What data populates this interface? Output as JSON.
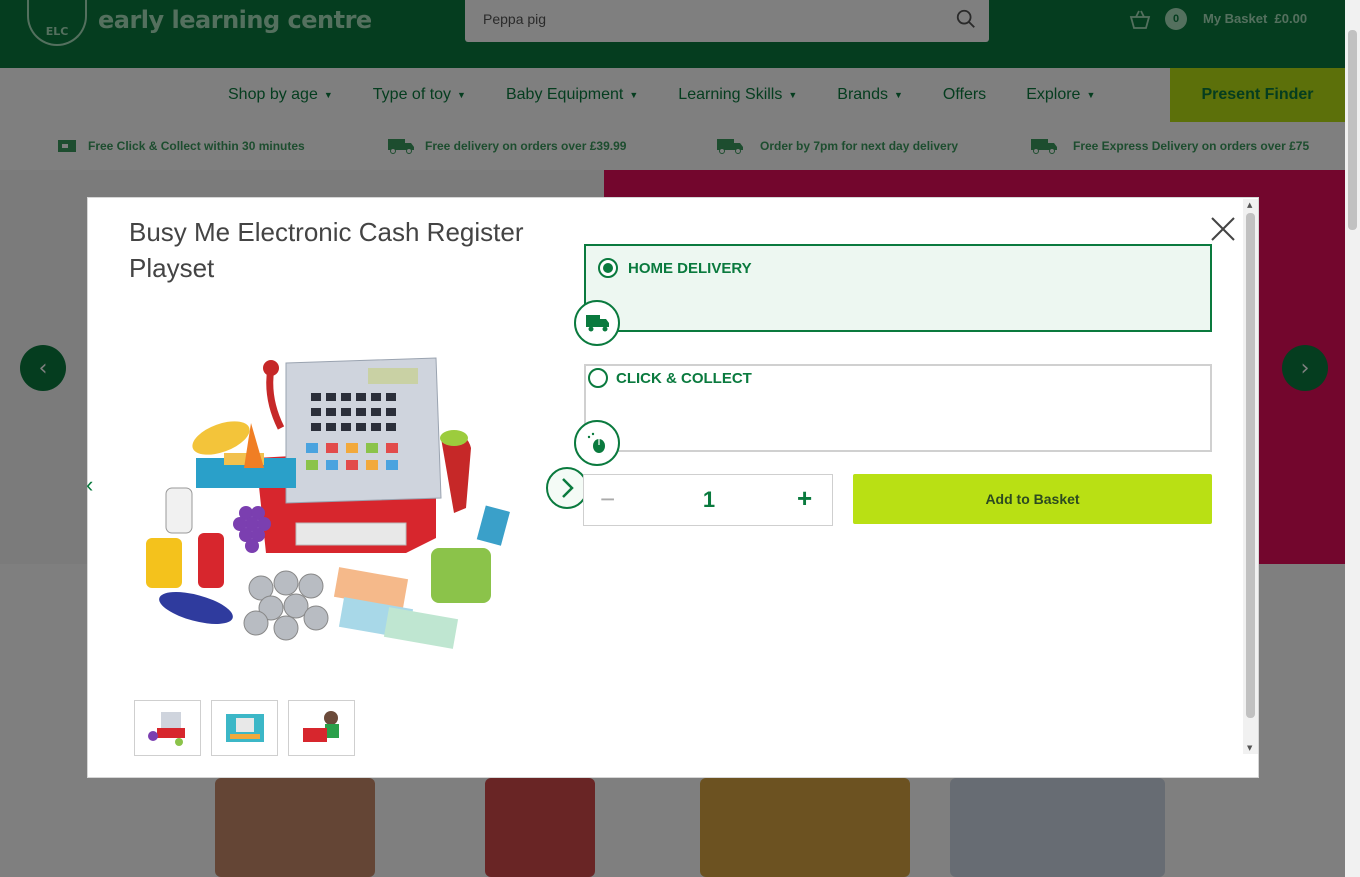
{
  "header": {
    "logo_badge": "ELC",
    "logo_text": "early learning centre",
    "search": {
      "value": "Peppa pig"
    },
    "basket": {
      "count": "0",
      "label": "My Basket",
      "total": "£0.00"
    }
  },
  "nav": {
    "items": [
      {
        "label": "Shop by age",
        "dropdown": true
      },
      {
        "label": "Type of toy",
        "dropdown": true
      },
      {
        "label": "Baby Equipment",
        "dropdown": true
      },
      {
        "label": "Learning Skills",
        "dropdown": true
      },
      {
        "label": "Brands",
        "dropdown": true
      },
      {
        "label": "Offers",
        "dropdown": false
      },
      {
        "label": "Explore",
        "dropdown": true
      }
    ],
    "present_finder": "Present Finder"
  },
  "usps": [
    {
      "text": "Free Click & Collect within 30 minutes"
    },
    {
      "text": "Free delivery on orders over £39.99"
    },
    {
      "text": "Order by 7pm for next day delivery"
    },
    {
      "text": "Free Express Delivery on orders over £75"
    }
  ],
  "modal": {
    "title": "Busy Me Electronic Cash Register Playset",
    "options": [
      {
        "label": "HOME DELIVERY",
        "selected": true,
        "icon": "delivery-truck-icon"
      },
      {
        "label": "CLICK & COLLECT",
        "selected": false,
        "icon": "mouse-click-icon"
      }
    ],
    "quantity": {
      "minus": "−",
      "value": "1",
      "plus": "+"
    },
    "add_to_basket": "Add to Basket",
    "thumbnails": [
      "cash-register-thumbnail",
      "boxed-product-thumbnail",
      "child-playing-thumbnail"
    ]
  },
  "colors": {
    "brand_green": "#0a7a3e",
    "accent_lime": "#b9e014",
    "hero_pink": "#e60c5a"
  }
}
